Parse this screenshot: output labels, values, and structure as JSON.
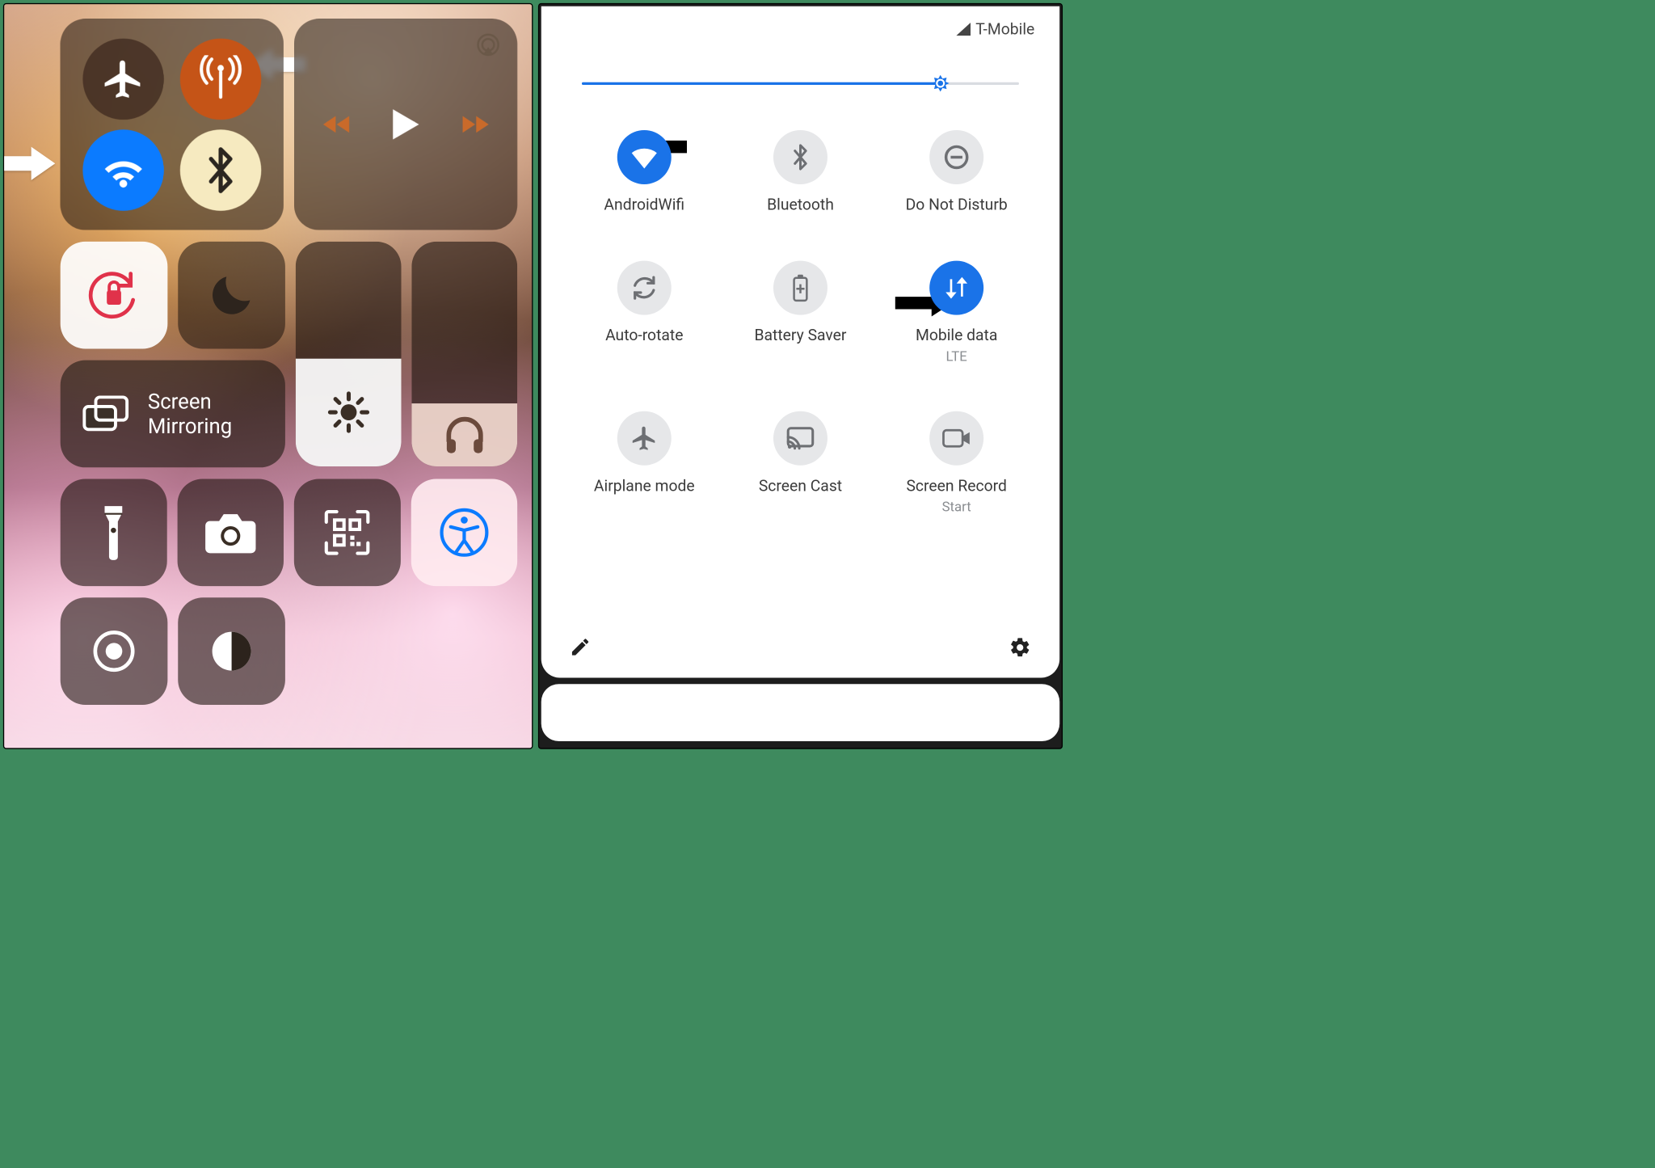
{
  "ios": {
    "screen_mirroring_label": "Screen\nMirroring",
    "brightness_percent": 48,
    "volume_percent": 28
  },
  "android": {
    "carrier": "T-Mobile",
    "brightness_percent": 82,
    "tiles": {
      "wifi": {
        "label": "AndroidWifi",
        "on": true
      },
      "bluetooth": {
        "label": "Bluetooth",
        "on": false
      },
      "dnd": {
        "label": "Do Not Disturb",
        "on": false
      },
      "autorotate": {
        "label": "Auto-rotate",
        "on": false
      },
      "battery_saver": {
        "label": "Battery Saver",
        "on": false
      },
      "mobile_data": {
        "label": "Mobile data",
        "sub": "LTE",
        "on": true
      },
      "airplane": {
        "label": "Airplane mode",
        "on": false
      },
      "screen_cast": {
        "label": "Screen Cast",
        "on": false
      },
      "screen_record": {
        "label": "Screen Record",
        "sub": "Start",
        "on": false
      }
    }
  }
}
